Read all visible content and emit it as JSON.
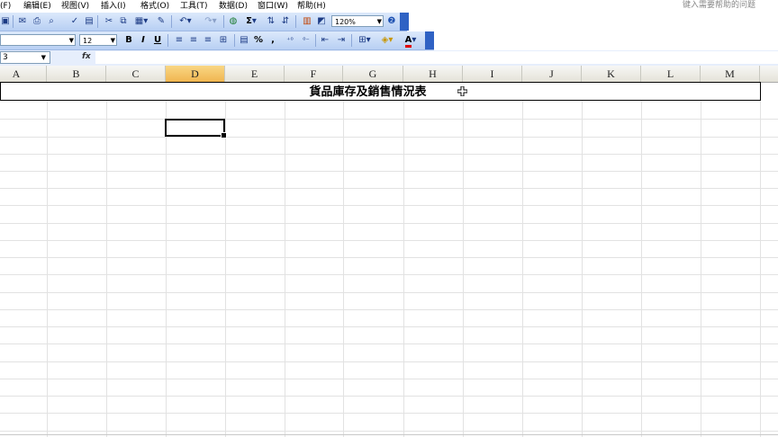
{
  "menubar": {
    "items": [
      "(F)",
      "编辑(E)",
      "视图(V)",
      "插入(I)",
      "格式(O)",
      "工具(T)",
      "数据(D)",
      "窗口(W)",
      "帮助(H)"
    ],
    "help_placeholder": "键入需要帮助的问题"
  },
  "toolbar_standard": {
    "zoom": "120%",
    "sigma": "Σ"
  },
  "toolbar_format": {
    "font_size": "12",
    "bold": "B",
    "italic": "I",
    "underline": "U",
    "percent": "%",
    "comma": ",",
    "font_color_letter": "A"
  },
  "formula_bar": {
    "name_box": "3",
    "fx_label": "fx",
    "formula": ""
  },
  "columns": [
    "A",
    "B",
    "C",
    "D",
    "E",
    "F",
    "G",
    "H",
    "I",
    "J",
    "K",
    "L",
    "M"
  ],
  "active_column": "D",
  "sheet": {
    "title": "貨品庫存及銷售情況表"
  },
  "colors": {
    "toolbar_top": "#dce9fb",
    "toolbar_bottom": "#b7cff3",
    "header_active": "#f0b550",
    "grid": "#e2e2e2"
  }
}
